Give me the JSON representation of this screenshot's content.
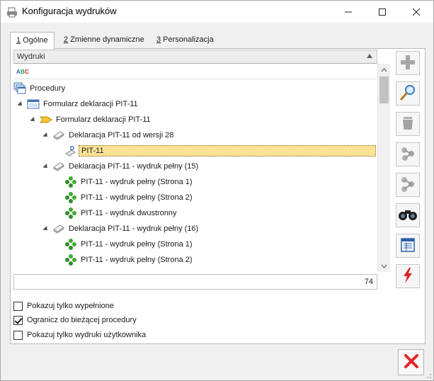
{
  "window": {
    "title": "Konfiguracja wydruków",
    "icon": "printer-config-icon"
  },
  "tabs": [
    {
      "key": "1",
      "label": " Ogólne",
      "active": true
    },
    {
      "key": "2",
      "label": " Zmienne dynamiczne",
      "active": false
    },
    {
      "key": "3",
      "label": " Personalizacja",
      "active": false
    }
  ],
  "grid": {
    "header": "Wydruki",
    "filter_icon": "abc-filter-icon",
    "count": "74"
  },
  "tree": [
    {
      "label": "Procedury",
      "icon": "procedures-icon",
      "level": 0,
      "expanded": false,
      "selected": false
    },
    {
      "label": "Formularz deklaracji PIT-11",
      "icon": "form-window-icon",
      "level": 1,
      "expanded": true,
      "selected": false
    },
    {
      "label": "Formularz deklaracji PIT-11",
      "icon": "folder-arrow-icon",
      "level": 2,
      "expanded": true,
      "selected": false
    },
    {
      "label": "Deklaracja PIT-11 od wersji 28",
      "icon": "pages-icon",
      "level": 3,
      "expanded": true,
      "selected": false
    },
    {
      "label": "PIT-11",
      "icon": "document-d-icon",
      "level": 4,
      "expanded": false,
      "selected": true
    },
    {
      "label": "Deklaracja PIT-11 - wydruk pełny (15)",
      "icon": "pages-icon",
      "level": 3,
      "expanded": true,
      "selected": false
    },
    {
      "label": "PIT-11 - wydruk pełny (Strona 1)",
      "icon": "green-dots-icon",
      "level": 4,
      "expanded": false,
      "selected": false
    },
    {
      "label": "PIT-11 - wydruk pełny (Strona 2)",
      "icon": "green-dots-icon",
      "level": 4,
      "expanded": false,
      "selected": false
    },
    {
      "label": "PIT-11 - wydruk dwustronny",
      "icon": "green-dots-icon",
      "level": 4,
      "expanded": false,
      "selected": false
    },
    {
      "label": "Deklaracja PIT-11 - wydruk pełny (16)",
      "icon": "pages-icon",
      "level": 3,
      "expanded": true,
      "selected": false
    },
    {
      "label": "PIT-11 - wydruk pełny (Strona 1)",
      "icon": "green-dots-icon",
      "level": 4,
      "expanded": false,
      "selected": false
    },
    {
      "label": "PIT-11 - wydruk pełny (Strona 2)",
      "icon": "green-dots-icon",
      "level": 4,
      "expanded": false,
      "selected": false
    }
  ],
  "side_buttons": [
    {
      "name": "add",
      "icon": "plus-icon",
      "enabled": false
    },
    {
      "name": "edit",
      "icon": "magnifier-icon",
      "enabled": true
    },
    {
      "name": "delete",
      "icon": "trash-icon",
      "enabled": false
    },
    {
      "name": "copy",
      "icon": "molecule-icon",
      "enabled": false
    },
    {
      "name": "paste",
      "icon": "molecule-icon",
      "enabled": false
    },
    {
      "name": "find",
      "icon": "binoculars-icon",
      "enabled": true
    },
    {
      "name": "columns",
      "icon": "table-columns-icon",
      "enabled": true
    },
    {
      "name": "run",
      "icon": "lightning-icon",
      "enabled": true
    }
  ],
  "options": [
    {
      "label": "Pokazuj tylko wypełnione",
      "checked": false
    },
    {
      "label": "Ogranicz do bieżącej procedury",
      "checked": true
    },
    {
      "label": "Pokazuj tylko wydruki użytkownika",
      "checked": false
    }
  ],
  "footer": {
    "cancel_icon": "red-x-icon"
  },
  "colors": {
    "selection": "#fbe395",
    "cancel_red": "#e3262b",
    "lightning_red": "#d9232d"
  }
}
